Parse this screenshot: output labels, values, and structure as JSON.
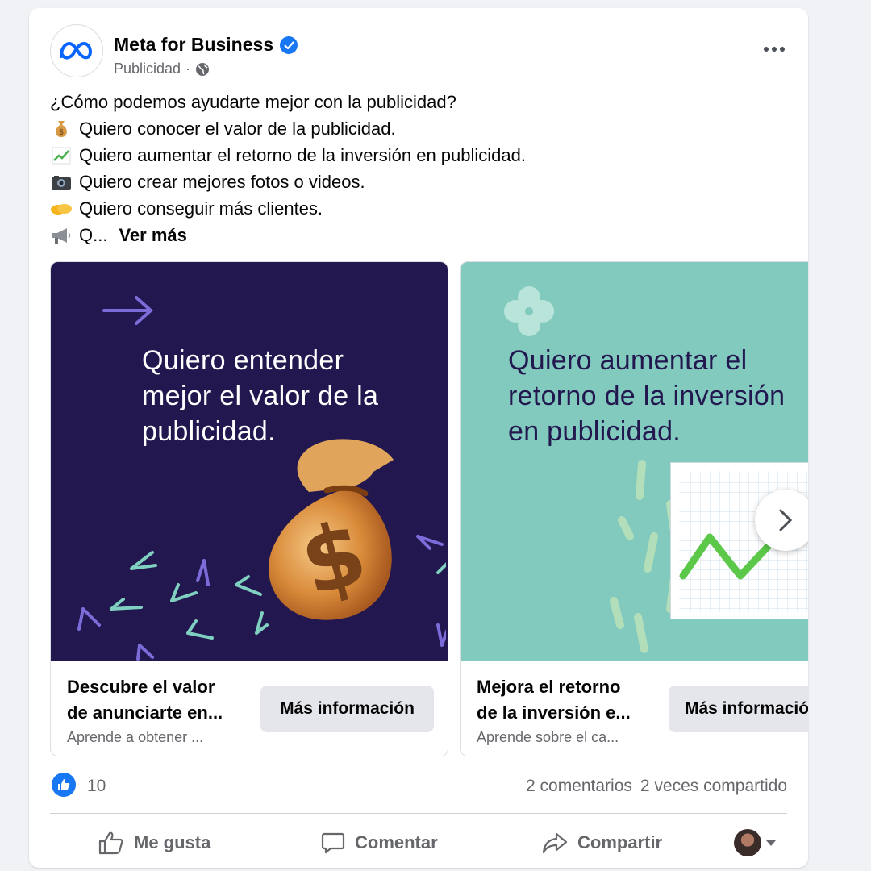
{
  "post": {
    "page_name": "Meta for Business",
    "sub_label": "Publicidad",
    "separator": "·",
    "body": {
      "question": "¿Cómo podemos ayudarte mejor con la publicidad?",
      "lines": [
        {
          "icon": "money-bag-icon",
          "text": "Quiero conocer el valor de la publicidad."
        },
        {
          "icon": "chart-increasing-icon",
          "text": "Quiero aumentar el retorno de la inversión en publicidad."
        },
        {
          "icon": "camera-icon",
          "text": "Quiero crear mejores fotos o videos."
        },
        {
          "icon": "handshake-icon",
          "text": "Quiero conseguir más clientes."
        },
        {
          "icon": "megaphone-icon",
          "text": "Q..."
        }
      ],
      "see_more": "Ver más"
    }
  },
  "carousel": {
    "cards": [
      {
        "image_headline": [
          "Quiero entender",
          "mejor el valor de la",
          "publicidad."
        ],
        "title": [
          "Descubre el valor",
          "de anunciarte en..."
        ],
        "description": "Aprende a obtener ...",
        "cta": "Más información",
        "colors": {
          "background": "#22184f",
          "headline": "#ffffff"
        }
      },
      {
        "image_headline": [
          "Quiero aumentar el",
          "retorno de la inversión",
          "en publicidad."
        ],
        "title": [
          "Mejora el retorno",
          "de la inversión e..."
        ],
        "description": "Aprende sobre el ca...",
        "cta": "Más información",
        "colors": {
          "background": "#82c9be",
          "headline": "#22184f"
        }
      }
    ]
  },
  "stats": {
    "likes": "10",
    "comments": "2 comentarios",
    "shares": "2 veces compartido"
  },
  "actions": {
    "like": "Me gusta",
    "comment": "Comentar",
    "share": "Compartir"
  },
  "colors": {
    "brand_blue": "#1877f2",
    "secondary_text": "#65676b",
    "button_bg": "#e4e6eb"
  }
}
